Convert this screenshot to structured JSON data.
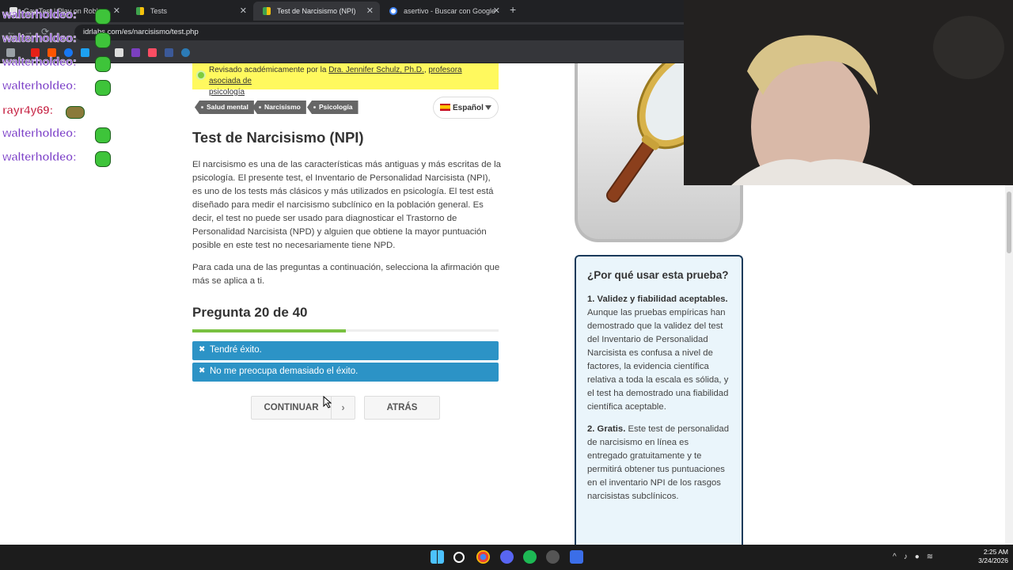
{
  "browser": {
    "tabs": [
      {
        "title": "Gay Test | Play on Roblox",
        "active": false
      },
      {
        "title": "Tests",
        "active": false
      },
      {
        "title": "Test de Narcisismo (NPI)",
        "active": true
      },
      {
        "title": "asertivo - Buscar con Google",
        "active": false
      }
    ],
    "url": "idrlabs.com/es/narcisismo/test.php",
    "new_tab_glyph": "+",
    "close_glyph": "✕"
  },
  "page": {
    "review": {
      "prefix": "Revisado académicamente por la ",
      "reviewer": "Dra. Jennifer Schulz, Ph.D.",
      "separator": ", ",
      "role_line1": "profesora asociada de",
      "role_line2": "psicología"
    },
    "tags": [
      "Salud mental",
      "Narcisismo",
      "Psicología"
    ],
    "language": "Español",
    "title": "Test de Narcisismo (NPI)",
    "intro": "El narcisismo es una de las características más antiguas y más escritas de la psicología. El presente test, el Inventario de Personalidad Narcisista (NPI), es uno de los tests más clásicos y más utilizados en psicología. El test está diseñado para medir el narcisismo subclínico en la población general. Es decir, el test no puede ser usado para diagnosticar el Trastorno de Personalidad Narcisista (NPD) y alguien que obtiene la mayor puntuación posible en este test no necesariamente tiene NPD.",
    "instruction": "Para cada una de las preguntas a continuación, selecciona la afirmación que más se aplica a ti.",
    "question": "Pregunta 20 de 40",
    "progress": 0.5,
    "options": [
      "Tendré éxito.",
      "No me preocupa demasiado el éxito."
    ],
    "option_mark": "✖",
    "buttons": {
      "continue": "CONTINUAR",
      "continue_arrow": "›",
      "back": "ATRÁS"
    }
  },
  "sidebar": {
    "why_title": "¿Por qué usar esta prueba?",
    "points": [
      {
        "heading": "1. Validez y fiabilidad aceptables.",
        "text": " Aunque las pruebas empíricas han demostrado que la validez del test del Inventario de Personalidad Narcisista es confusa a nivel de factores, la evidencia científica relativa a toda la escala es sólida, y el test ha demostrado una fiabilidad científica aceptable."
      },
      {
        "heading": "2. Gratis.",
        "text": " Este test de personalidad de narcisismo en línea es entregado gratuitamente y te permitirá obtener tus puntuaciones en el inventario NPI de los rasgos narcisistas subclínicos."
      }
    ]
  },
  "overlay": {
    "chat": [
      {
        "user": "walterholdeo:"
      },
      {
        "user": "walterholdeo:"
      },
      {
        "user": "walterholdeo:"
      },
      {
        "user": "walterholdeo:"
      },
      {
        "user": "rayr4y69:"
      },
      {
        "user": "walterholdeo:"
      },
      {
        "user": "walterholdeo:"
      }
    ],
    "chat_color": "#7c40c8"
  },
  "taskbar": {
    "time": "2:25 AM",
    "date": "3/24/2026"
  },
  "colors": {
    "option_blue": "#2c93c6",
    "progress_green": "#79c140",
    "review_yellow": "#fff95e",
    "tag_gray": "#666666"
  }
}
